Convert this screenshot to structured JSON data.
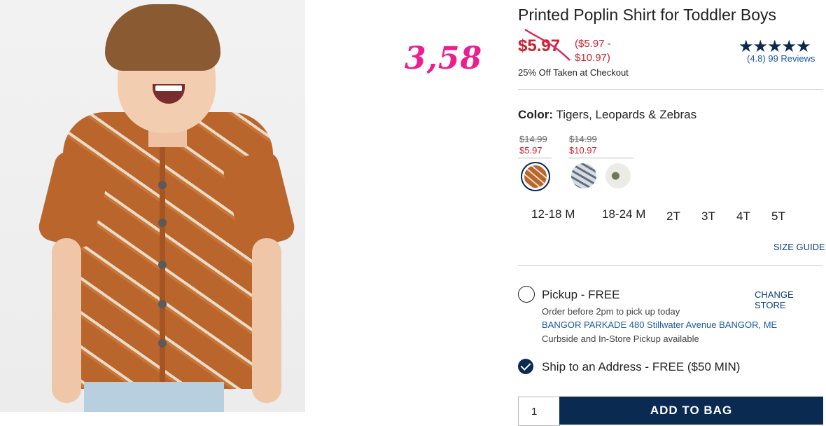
{
  "annotation": {
    "text": "3,58"
  },
  "product": {
    "title": "Printed Poplin Shirt for Toddler Boys",
    "sale_price": "$5.97",
    "price_range_line1": "($5.97 -",
    "price_range_line2": "$10.97)",
    "checkout_note": "25% Off Taken at Checkout",
    "rating_stars": "★★★★★",
    "rating_value": 4.8,
    "reviews_text": "(4.8) 99 Reviews"
  },
  "color": {
    "label": "Color:",
    "value": "Tigers, Leopards & Zebras",
    "groups": [
      {
        "old": "$14.99",
        "new": "$5.97"
      },
      {
        "old": "$14.99",
        "new": "$10.97"
      }
    ]
  },
  "sizes": [
    "12-18 M",
    "18-24 M",
    "2T",
    "3T",
    "4T",
    "5T"
  ],
  "size_guide": "SIZE GUIDE",
  "fulfillment": {
    "pickup_label": "Pickup - FREE",
    "change_store": "CHANGE STORE",
    "order_note": "Order before 2pm to pick up today",
    "store_address": "BANGOR PARKADE 480 Stillwater Avenue  BANGOR, ME",
    "curbside": "Curbside and In-Store Pickup available",
    "ship_label": "Ship to an Address - FREE ($50 MIN)"
  },
  "cart": {
    "qty": "1",
    "add_to_bag": "ADD TO BAG"
  },
  "colors": {
    "sale_red": "#cc1f2f",
    "navy": "#0b2a52",
    "link_blue": "#1c5aa5",
    "annotation_pink": "#ee1d8f"
  }
}
